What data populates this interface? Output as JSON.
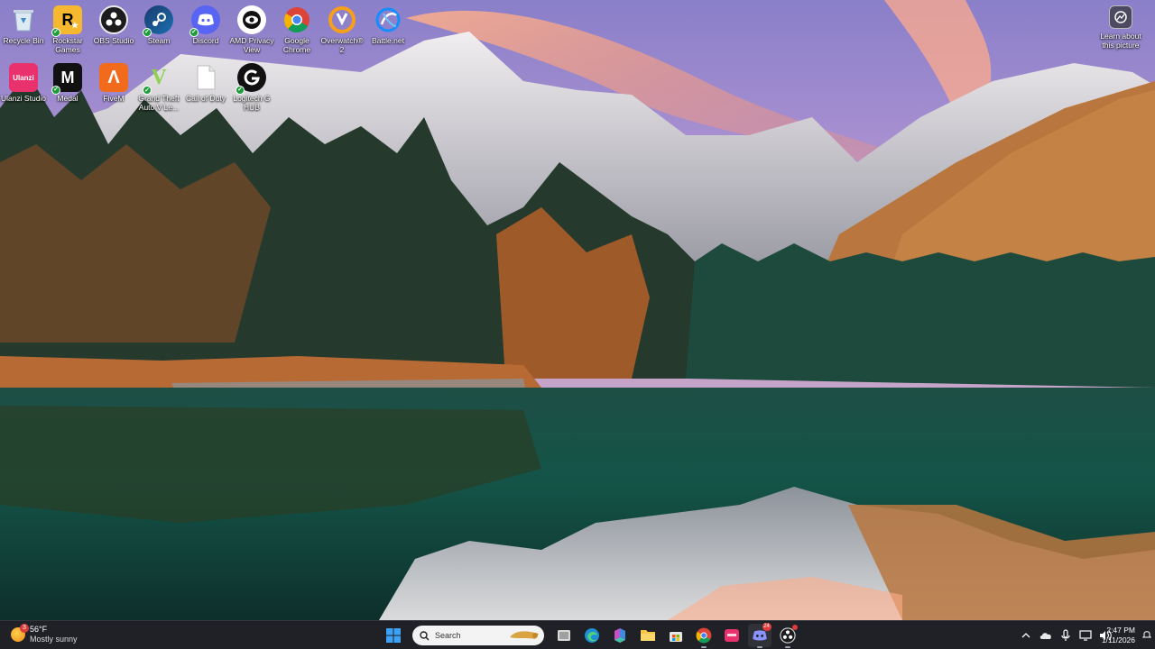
{
  "desktop": {
    "icons_row1": [
      {
        "label": "Recycle Bin",
        "icon": "recycle-bin-icon"
      },
      {
        "label": "Rockstar Games",
        "icon": "rockstar-icon"
      },
      {
        "label": "OBS Studio",
        "icon": "obs-icon"
      },
      {
        "label": "Steam",
        "icon": "steam-icon"
      },
      {
        "label": "Discord",
        "icon": "discord-icon"
      },
      {
        "label": "AMD Privacy View",
        "icon": "amd-privacy-icon"
      },
      {
        "label": "Google Chrome",
        "icon": "chrome-icon"
      },
      {
        "label": "Overwatch® 2",
        "icon": "overwatch-icon"
      },
      {
        "label": "Battle.net",
        "icon": "battlenet-icon"
      }
    ],
    "icons_row2": [
      {
        "label": "Ulanzi Studio",
        "icon": "ulanzi-icon"
      },
      {
        "label": "Medal",
        "icon": "medal-icon"
      },
      {
        "label": "FiveM",
        "icon": "fivem-icon"
      },
      {
        "label": "Grand Theft Auto V Le...",
        "icon": "gta-icon"
      },
      {
        "label": "Call of Duty",
        "icon": "file-icon"
      },
      {
        "label": "Logitech G HUB",
        "icon": "logitech-icon"
      }
    ],
    "learn_label": "Learn about this picture"
  },
  "taskbar": {
    "weather_temp": "56°F",
    "weather_cond": "Mostly sunny",
    "weather_badge": "3",
    "search_placeholder": "Search",
    "time": "2:47 PM",
    "date": "1/11/2026",
    "discord_badge": "24"
  },
  "colors": {
    "taskbar_bg": "#1f2126",
    "accent": "#0078d4"
  }
}
